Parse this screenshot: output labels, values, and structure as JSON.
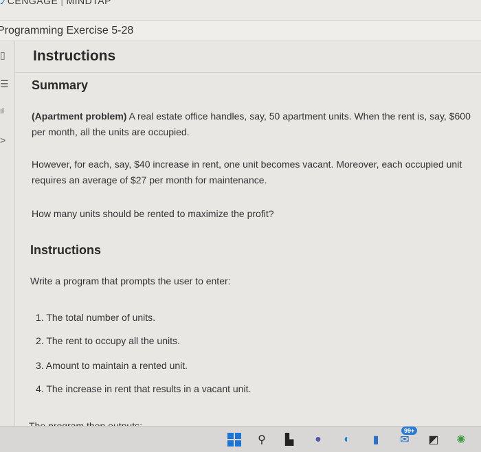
{
  "brand": {
    "left": "CENGAGE",
    "separator": "|",
    "right": "MINDTAP"
  },
  "exercise_title": "Programming Exercise 5-28",
  "instructions_header": "Instructions",
  "summary": {
    "heading": "Summary",
    "p1_bold": "(Apartment problem)",
    "p1_rest": " A real estate office handles, say, 50 apartment units. When the rent is, say, $600 per month, all the units are occupied.",
    "p2": "However, for each, say, $40 increase in rent, one unit becomes vacant. Moreover, each occupied unit requires an average of $27 per month for maintenance.",
    "p3": "How many units should be rented to maximize the profit?"
  },
  "instructions": {
    "heading": "Instructions",
    "intro": "Write a program that prompts the user to enter:",
    "items": [
      "1. The total number of units.",
      "2. The rent to occupy all the units.",
      "3. Amount to maintain a rented unit.",
      "4. The increase in rent that results in a vacant unit."
    ],
    "cut_line": "The program then outputs:"
  },
  "taskbar": {
    "icons": [
      "windows-start-icon",
      "search-icon",
      "file-explorer-icon",
      "teams-icon",
      "edge-icon",
      "store-icon",
      "mail-icon",
      "app-icon",
      "browser-icon"
    ],
    "badge": "99+"
  }
}
